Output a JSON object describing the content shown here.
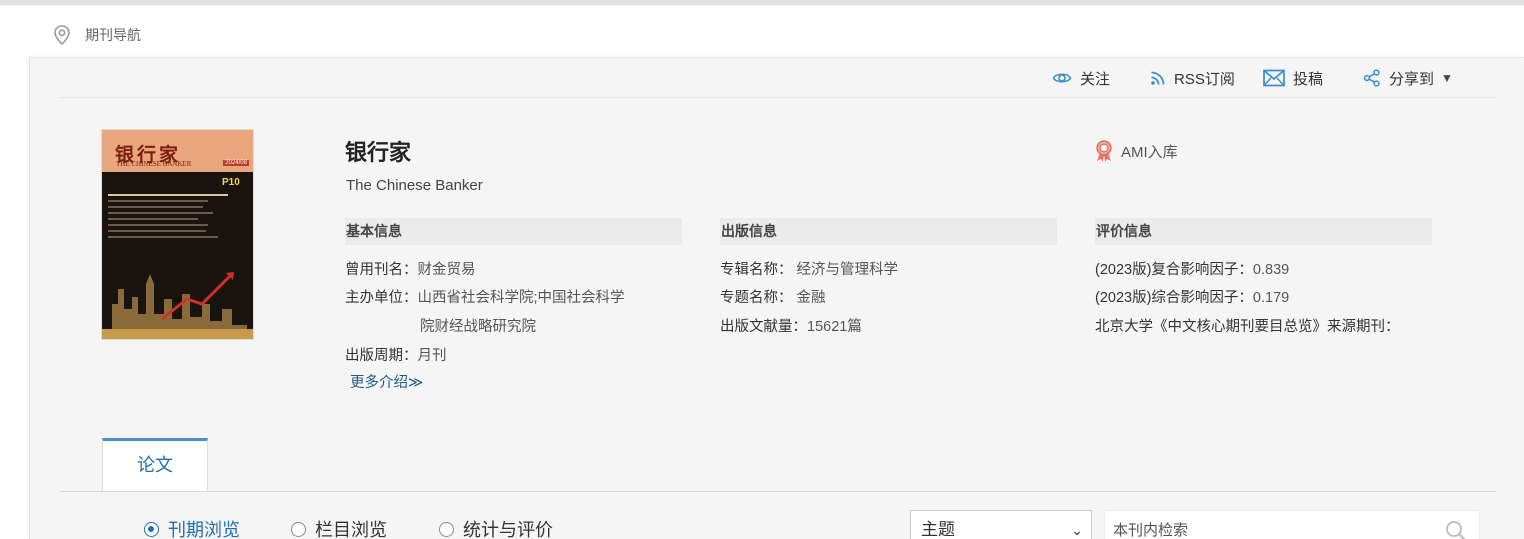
{
  "breadcrumb": {
    "label": "期刊导航"
  },
  "toolbar": {
    "follow": "关注",
    "rss": "RSS订阅",
    "submit": "投稿",
    "share": "分享到"
  },
  "cover": {
    "title": "银行家",
    "subtitle": "THE CHINESE BANKER",
    "issue": "2024/08",
    "page_tag": "P10"
  },
  "journal": {
    "title": "银行家",
    "english_title": "The Chinese Banker",
    "ami_badge": "AMI入库"
  },
  "basic_info": {
    "heading": "基本信息",
    "former_name_label": "曾用刊名：",
    "former_name": "财金贸易",
    "sponsor_label": "主办单位：",
    "sponsor_line1": "山西省社会科学院;中国社会科学",
    "sponsor_line2": "院财经战略研究院",
    "cycle_label": "出版周期：",
    "cycle": "月刊",
    "more": "更多介绍≫"
  },
  "pub_info": {
    "heading": "出版信息",
    "album_label": "专辑名称：",
    "album": "经济与管理科学",
    "topic_label": "专题名称：",
    "topic": "金融",
    "count_label": "出版文献量：",
    "count": "15621篇"
  },
  "eval_info": {
    "heading": "评价信息",
    "composite_label": "(2023版)复合影响因子：",
    "composite": "0.839",
    "comprehensive_label": "(2023版)综合影响因子：",
    "comprehensive": "0.179",
    "pku_label": "北京大学《中文核心期刊要目总览》来源期刊："
  },
  "tabs": {
    "papers": "论文"
  },
  "browse": {
    "by_issue": "刊期浏览",
    "by_column": "栏目浏览",
    "stats": "统计与评价"
  },
  "search": {
    "field_selected": "主题",
    "placeholder": "本刊内检索"
  },
  "colors": {
    "accent": "#1f6fb0",
    "link": "#1a5b8a",
    "tab_border": "#4a90c8"
  }
}
